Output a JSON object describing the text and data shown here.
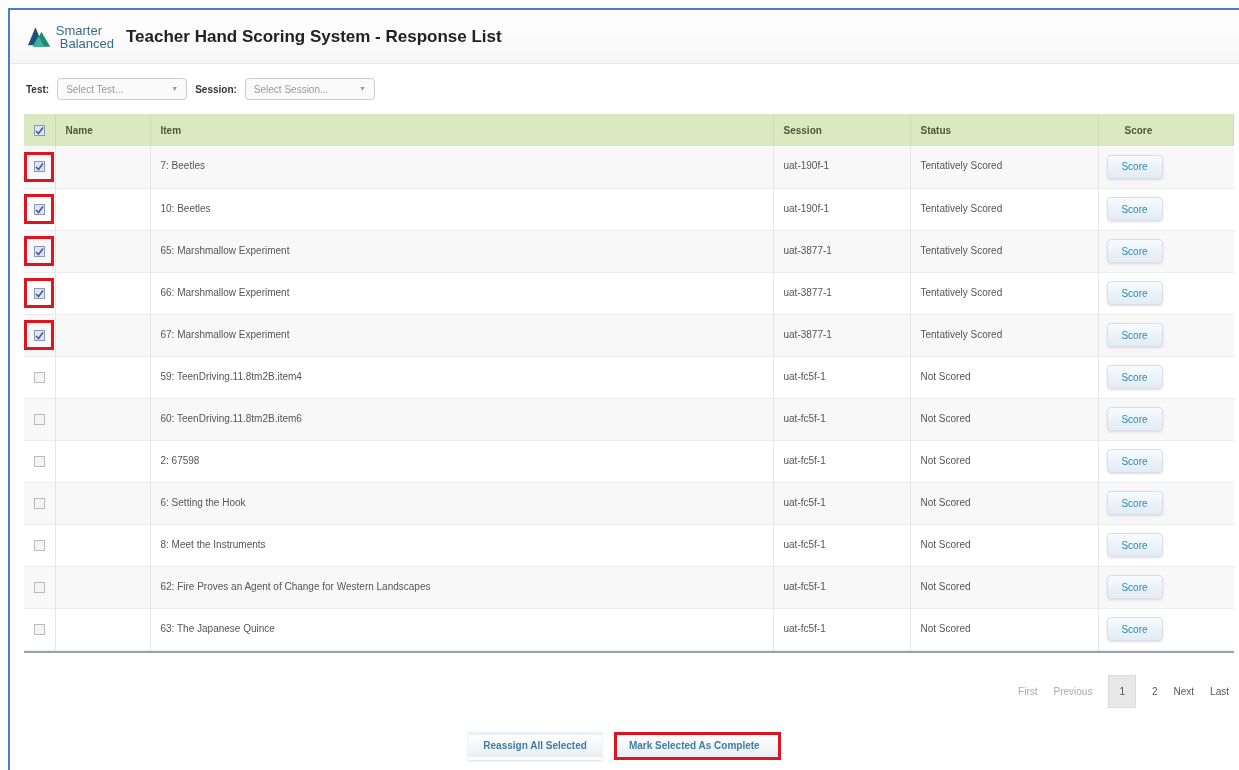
{
  "header": {
    "logo_line_1": "Smarter",
    "logo_line_2": "Balanced",
    "title": "Teacher Hand Scoring System - Response List"
  },
  "filters": [
    {
      "label": "Test:",
      "placeholder": "Select Test...",
      "arrow": "▼"
    },
    {
      "label": "Session:",
      "placeholder": "Select Session...",
      "arrow": "▼"
    }
  ],
  "table": {
    "select_all": {
      "checked": true
    },
    "columns": [
      "Name",
      "Item",
      "Session",
      "Status",
      "Score"
    ],
    "rows": [
      {
        "checked": true,
        "highlighted": true,
        "name": "",
        "item": "7: Beetles",
        "session": "uat-190f-1",
        "status": "Tentatively Scored",
        "action": "Score"
      },
      {
        "checked": true,
        "highlighted": true,
        "name": "",
        "item": "10: Beetles",
        "session": "uat-190f-1",
        "status": "Tentatively Scored",
        "action": "Score"
      },
      {
        "checked": true,
        "highlighted": true,
        "name": "",
        "item": "65: Marshmallow Experiment",
        "session": "uat-3877-1",
        "status": "Tentatively Scored",
        "action": "Score"
      },
      {
        "checked": true,
        "highlighted": true,
        "name": "",
        "item": "66: Marshmallow Experiment",
        "session": "uat-3877-1",
        "status": "Tentatively Scored",
        "action": "Score"
      },
      {
        "checked": true,
        "highlighted": true,
        "name": "",
        "item": "67: Marshmallow Experiment",
        "session": "uat-3877-1",
        "status": "Tentatively Scored",
        "action": "Score"
      },
      {
        "checked": false,
        "highlighted": false,
        "name": "",
        "item": "59: TeenDriving.11.8tm2B.item4",
        "session": "uat-fc5f-1",
        "status": "Not Scored",
        "action": "Score"
      },
      {
        "checked": false,
        "highlighted": false,
        "name": "",
        "item": "60: TeenDriving.11.8tm2B.item6",
        "session": "uat-fc5f-1",
        "status": "Not Scored",
        "action": "Score"
      },
      {
        "checked": false,
        "highlighted": false,
        "name": "",
        "item": "2: 67598",
        "session": "uat-fc5f-1",
        "status": "Not Scored",
        "action": "Score"
      },
      {
        "checked": false,
        "highlighted": false,
        "name": "",
        "item": "6: Setting the Hook",
        "session": "uat-fc5f-1",
        "status": "Not Scored",
        "action": "Score"
      },
      {
        "checked": false,
        "highlighted": false,
        "name": "",
        "item": "8: Meet the Instruments",
        "session": "uat-fc5f-1",
        "status": "Not Scored",
        "action": "Score"
      },
      {
        "checked": false,
        "highlighted": false,
        "name": "",
        "item": "62: Fire Proves an Agent of Change for Western Landscapes",
        "session": "uat-fc5f-1",
        "status": "Not Scored",
        "action": "Score"
      },
      {
        "checked": false,
        "highlighted": false,
        "name": "",
        "item": "63: The Japanese Quince",
        "session": "uat-fc5f-1",
        "status": "Not Scored",
        "action": "Score"
      }
    ]
  },
  "pagination": [
    {
      "label": "First",
      "kind": "nav",
      "selected": false
    },
    {
      "label": "Previous",
      "kind": "nav",
      "selected": false
    },
    {
      "label": "1",
      "kind": "page",
      "selected": true
    },
    {
      "label": "2",
      "kind": "page",
      "selected": false
    },
    {
      "label": "Next",
      "kind": "nav",
      "selected": false
    },
    {
      "label": "Last",
      "kind": "nav",
      "selected": false
    }
  ],
  "actions": [
    {
      "label": "Reassign All Selected",
      "highlighted": false
    },
    {
      "label": "Mark Selected As Complete",
      "highlighted": true
    }
  ]
}
